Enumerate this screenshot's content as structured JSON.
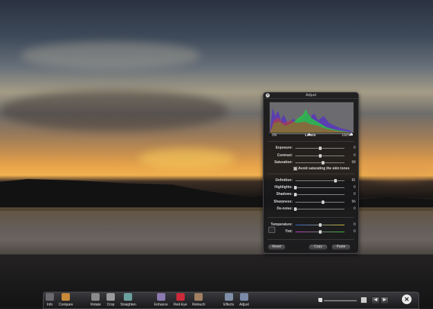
{
  "hud": {
    "title": "Adjust",
    "levels": {
      "label": "Levels",
      "left": "0%",
      "right": "100%"
    },
    "sliders": [
      {
        "label": "Exposure:",
        "value": "0",
        "pos": 0.5
      },
      {
        "label": "Contrast:",
        "value": "0",
        "pos": 0.5
      },
      {
        "label": "Saturation:",
        "value": "58",
        "pos": 0.56
      },
      {
        "label": "Definition:",
        "value": "81",
        "pos": 0.81
      },
      {
        "label": "Highlights:",
        "value": "0",
        "pos": 0.0
      },
      {
        "label": "Shadows:",
        "value": "0",
        "pos": 0.0
      },
      {
        "label": "Sharpness:",
        "value": "56",
        "pos": 0.56
      },
      {
        "label": "De-noise:",
        "value": "0",
        "pos": 0.0
      },
      {
        "label": "Temperature:",
        "value": "0",
        "pos": 0.5
      },
      {
        "label": "Tint:",
        "value": "0",
        "pos": 0.5
      }
    ],
    "avoid_skin": "Avoid saturating the skin tones",
    "buttons": {
      "reset": "Reset",
      "copy": "Copy",
      "paste": "Paste"
    }
  },
  "toolbar": {
    "items": [
      {
        "label": "Info",
        "icon": "info-icon",
        "color": "#6a6a6e"
      },
      {
        "label": "Compare",
        "icon": "compare-icon",
        "color": "#c98a3a"
      },
      {
        "label": "Rotate",
        "icon": "rotate-icon",
        "color": "#8a8a8a"
      },
      {
        "label": "Crop",
        "icon": "crop-icon",
        "color": "#9a9a9a"
      },
      {
        "label": "Straighten",
        "icon": "straighten-icon",
        "color": "#6aa0a0"
      },
      {
        "label": "Enhance",
        "icon": "enhance-icon",
        "color": "#8a7ab0"
      },
      {
        "label": "Red-Eye",
        "icon": "red-eye-icon",
        "color": "#cc2a3a"
      },
      {
        "label": "Retouch",
        "icon": "retouch-icon",
        "color": "#a08060"
      },
      {
        "label": "Effects",
        "icon": "effects-icon",
        "color": "#8090a8"
      },
      {
        "label": "Adjust",
        "icon": "adjust-icon",
        "color": "#7a8aa8"
      }
    ],
    "prev": "◀",
    "next": "▶",
    "close": "✕"
  }
}
